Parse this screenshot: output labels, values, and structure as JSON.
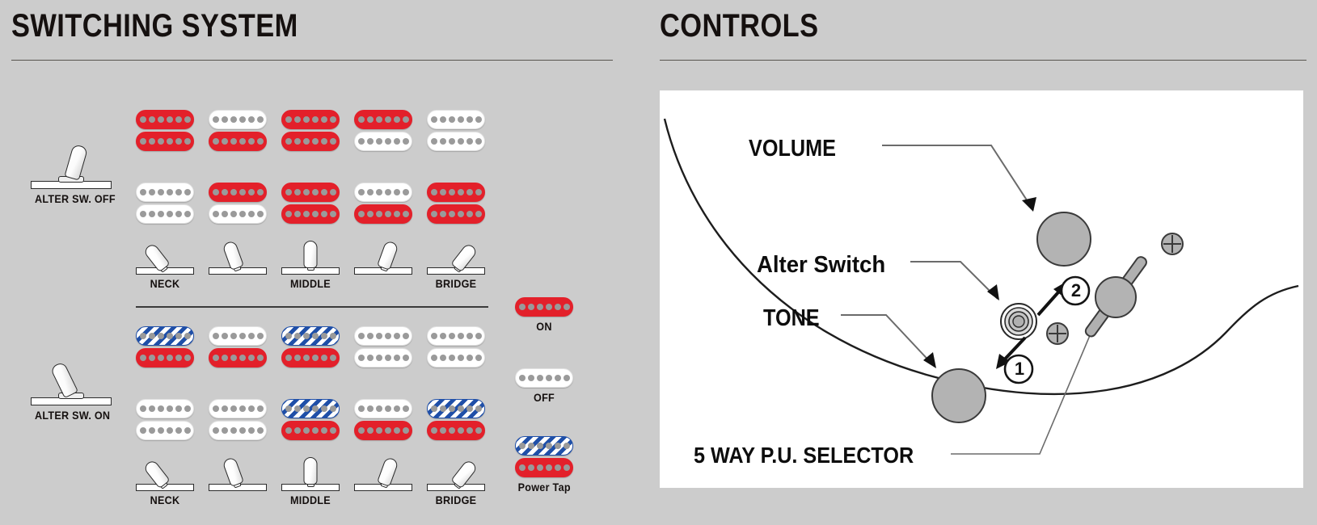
{
  "panels": {
    "switching": {
      "title": "SWITCHING SYSTEM"
    },
    "controls": {
      "title": "CONTROLS"
    }
  },
  "switching_system": {
    "groups": [
      {
        "id": "alter-sw-off",
        "toggle_label": "ALTER SW. OFF",
        "toggle_state": "off",
        "positions": [
          {
            "index": 1,
            "label": "NECK",
            "lever_angle": -38,
            "coils": [
              "red",
              "red"
            ]
          },
          {
            "index": 2,
            "label": "",
            "lever_angle": -20,
            "coils": [
              "white",
              "red"
            ]
          },
          {
            "index": 3,
            "label": "MIDDLE",
            "lever_angle": 0,
            "coils": [
              "red",
              "red"
            ]
          },
          {
            "index": 4,
            "label": "",
            "lever_angle": 20,
            "coils": [
              "red",
              "white"
            ]
          },
          {
            "index": 5,
            "label": "BRIDGE",
            "lever_angle": 38,
            "coils": [
              "white",
              "white"
            ]
          }
        ],
        "bridge_row": [
          {
            "index": 1,
            "coils": [
              "white",
              "white"
            ]
          },
          {
            "index": 2,
            "coils": [
              "red",
              "white"
            ]
          },
          {
            "index": 3,
            "coils": [
              "red",
              "red"
            ]
          },
          {
            "index": 4,
            "coils": [
              "white",
              "red"
            ]
          },
          {
            "index": 5,
            "coils": [
              "red",
              "red"
            ]
          }
        ]
      },
      {
        "id": "alter-sw-on",
        "toggle_label": "ALTER SW. ON",
        "toggle_state": "on",
        "positions": [
          {
            "index": 1,
            "label": "NECK",
            "lever_angle": -38,
            "coils": [
              "blue",
              "red"
            ]
          },
          {
            "index": 2,
            "label": "",
            "lever_angle": -20,
            "coils": [
              "white",
              "red"
            ]
          },
          {
            "index": 3,
            "label": "MIDDLE",
            "lever_angle": 0,
            "coils": [
              "blue",
              "red"
            ]
          },
          {
            "index": 4,
            "label": "",
            "lever_angle": 20,
            "coils": [
              "white",
              "white"
            ]
          },
          {
            "index": 5,
            "label": "BRIDGE",
            "lever_angle": 38,
            "coils": [
              "white",
              "white"
            ]
          }
        ],
        "bridge_row": [
          {
            "index": 1,
            "coils": [
              "white",
              "white"
            ]
          },
          {
            "index": 2,
            "coils": [
              "white",
              "white"
            ]
          },
          {
            "index": 3,
            "coils": [
              "blue",
              "red"
            ]
          },
          {
            "index": 4,
            "coils": [
              "white",
              "red"
            ]
          },
          {
            "index": 5,
            "coils": [
              "blue",
              "red"
            ]
          }
        ]
      }
    ],
    "legend": [
      {
        "id": "on",
        "label": "ON",
        "coils": [
          "red"
        ]
      },
      {
        "id": "off",
        "label": "OFF",
        "coils": [
          "white"
        ]
      },
      {
        "id": "power-tap",
        "label": "Power Tap",
        "coils": [
          "blue",
          "red"
        ]
      }
    ]
  },
  "controls": {
    "labels": {
      "volume": "VOLUME",
      "alter_switch": "Alter Switch",
      "tone": "TONE",
      "selector": "5 WAY P.U. SELECTOR"
    },
    "markers": [
      {
        "id": "marker-1",
        "text": "1"
      },
      {
        "id": "marker-2",
        "text": "2"
      }
    ]
  },
  "colors": {
    "background": "#cccccc",
    "board": "#ffffff",
    "coil_on": "#e3202a",
    "coil_off": "#ffffff",
    "coil_power_tap": "#1f4fa8",
    "knob": "#b3b3b3",
    "text": "#0d0d0d",
    "rule": "#58544f"
  }
}
